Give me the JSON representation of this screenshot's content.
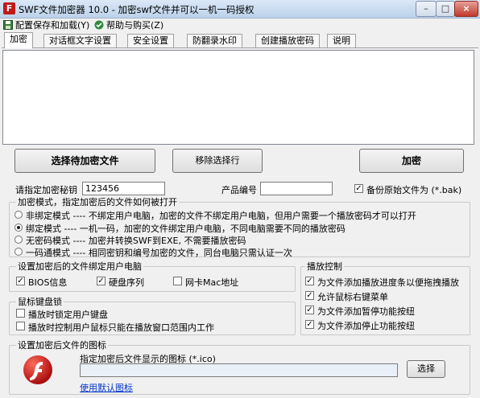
{
  "window": {
    "title": "SWF文件加密器 10.0 - 加密swf文件并可以一机一码授权",
    "icon_glyph": "F",
    "minimize_glyph": "–",
    "maximize_glyph": "□",
    "close_glyph": "×"
  },
  "menu": {
    "items": [
      {
        "label": "配置保存和加载(Y)",
        "icon": "save-icon"
      },
      {
        "label": "帮助与购买(Z)",
        "icon": "help-icon"
      }
    ]
  },
  "tabs": [
    "加密",
    "对话框文字设置",
    "安全设置",
    "防翻录水印",
    "创建播放密码",
    "说明"
  ],
  "active_tab": "加密",
  "buttons": {
    "select_files": "选择待加密文件",
    "remove_selected": "移除选择行",
    "encrypt": "加密",
    "choose_icon": "选择"
  },
  "key": {
    "label": "请指定加密秘钥",
    "value": "123456"
  },
  "product": {
    "label": "产品编号",
    "value": ""
  },
  "backup": {
    "label": "备份原始文件为 (*.bak)",
    "checked": true
  },
  "mode_group": {
    "title": "加密模式，指定加密后的文件如何被打开",
    "options": [
      {
        "label": "非绑定模式 ---- 不绑定用户电脑，加密的文件不绑定用户电脑，但用户需要一个播放密码才可以打开",
        "selected": false
      },
      {
        "label": "绑定模式 ---- 一机一码，加密的文件绑定用户电脑，不同电脑需要不同的播放密码",
        "selected": true
      },
      {
        "label": "无密码模式 ---- 加密并转换SWF到EXE, 不需要播放密码",
        "selected": false
      },
      {
        "label": "一码通模式 ---- 相同密钥和编号加密的文件，同台电脑只需认证一次",
        "selected": false
      }
    ]
  },
  "bind_group": {
    "title": "设置加密后的文件绑定用户电脑",
    "options": [
      {
        "label": "BIOS信息",
        "checked": true
      },
      {
        "label": "硬盘序列",
        "checked": true
      },
      {
        "label": "网卡Mac地址",
        "checked": false
      }
    ]
  },
  "kbmouse_group": {
    "title": "鼠标键盘锁",
    "options": [
      {
        "label": "播放时锁定用户键盘",
        "checked": false
      },
      {
        "label": "播放时控制用户鼠标只能在播放窗口范围内工作",
        "checked": false
      }
    ]
  },
  "play_group": {
    "title": "播放控制",
    "options": [
      {
        "label": "为文件添加播放进度条以便拖拽播放",
        "checked": true
      },
      {
        "label": "允许鼠标右键菜单",
        "checked": true
      },
      {
        "label": "为文件添加暂停功能按纽",
        "checked": true
      },
      {
        "label": "为文件添加停止功能按纽",
        "checked": true
      }
    ]
  },
  "icon_group": {
    "title": "设置加密后文件的图标",
    "prompt": "指定加密后文件显示的图标 (*.ico)",
    "path_value": "",
    "default_link": "使用默认图标"
  },
  "colors": {
    "title_gradient_top": "#dbe8f7",
    "close_button": "#c0392b",
    "flash_icon": "#c31818",
    "link": "#0033cc",
    "path_field": "#eaf0f8"
  }
}
